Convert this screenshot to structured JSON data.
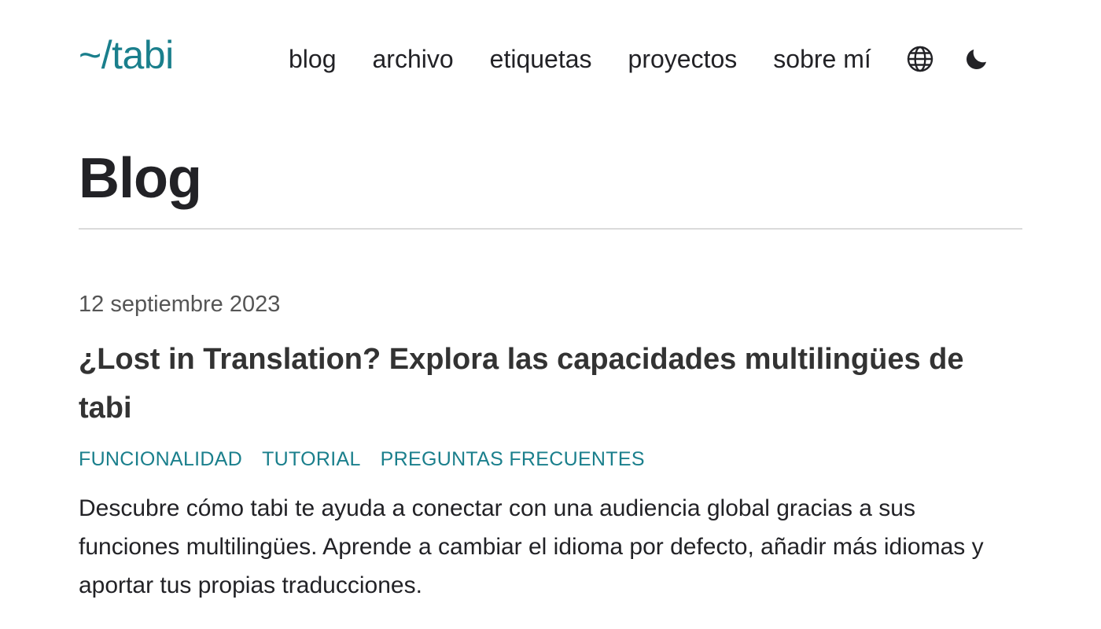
{
  "header": {
    "logo": "~/tabi",
    "nav": [
      {
        "label": "blog"
      },
      {
        "label": "archivo"
      },
      {
        "label": "etiquetas"
      },
      {
        "label": "proyectos"
      },
      {
        "label": "sobre mí"
      }
    ],
    "icons": {
      "language": "globe-icon",
      "theme": "moon-icon"
    }
  },
  "colors": {
    "accent": "#1a7f8c",
    "text": "#222226",
    "muted": "#555555",
    "divider": "#dadada"
  },
  "main": {
    "title": "Blog",
    "posts": [
      {
        "date": "12 septiembre 2023",
        "title": "¿Lost in Translation? Explora las capacidades multilingües de tabi",
        "tags": [
          "FUNCIONALIDAD",
          "TUTORIAL",
          "PREGUNTAS FRECUENTES"
        ],
        "summary": "Descubre cómo tabi te ayuda a conectar con una audiencia global gracias a sus funciones multilingües. Aprende a cambiar el idioma por defecto, añadir más idiomas y aportar tus propias traducciones."
      }
    ]
  }
}
